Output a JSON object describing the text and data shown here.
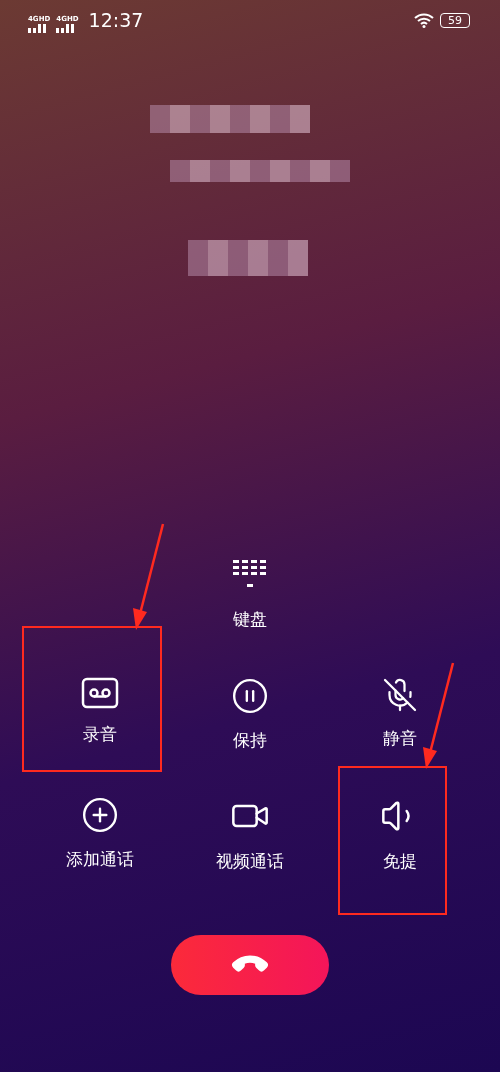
{
  "status_bar": {
    "signals": [
      {
        "network": "4G",
        "badge": "HD"
      },
      {
        "network": "4G",
        "badge": "HD"
      }
    ],
    "time": "12:37",
    "battery": "59"
  },
  "keypad": {
    "label": "键盘"
  },
  "controls": [
    {
      "label": "录音",
      "highlighted": true
    },
    {
      "label": "保持",
      "highlighted": false
    },
    {
      "label": "静音",
      "highlighted": false
    },
    {
      "label": "添加通话",
      "highlighted": false
    },
    {
      "label": "视频通话",
      "highlighted": false
    },
    {
      "label": "免提",
      "highlighted": true
    }
  ]
}
